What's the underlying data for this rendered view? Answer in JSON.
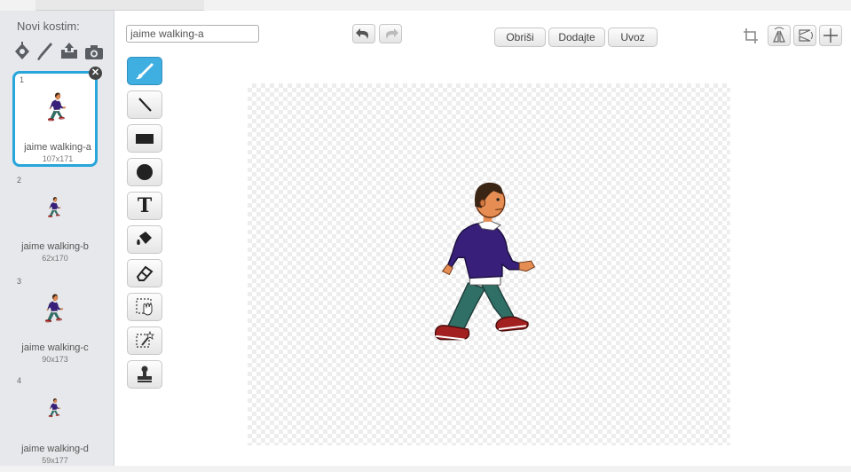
{
  "left_panel": {
    "new_costume_label": "Novi kostim:",
    "new_costume_tools": [
      "paint-new-costume-icon",
      "brush-new-icon",
      "upload-costume-icon",
      "camera-icon"
    ],
    "costumes": [
      {
        "number": "1",
        "name": "jaime walking-a",
        "size": "107x171",
        "selected": true
      },
      {
        "number": "2",
        "name": "jaime walking-b",
        "size": "62x170",
        "selected": false
      },
      {
        "number": "3",
        "name": "jaime walking-c",
        "size": "90x173",
        "selected": false
      },
      {
        "number": "4",
        "name": "jaime walking-d",
        "size": "59x177",
        "selected": false
      }
    ]
  },
  "editor": {
    "costume_name_value": "jaime walking-a",
    "toolbar": {
      "clear_label": "Obriši",
      "add_label": "Dodajte",
      "import_label": "Uvoz"
    },
    "right_tools": [
      "crop-icon",
      "flip-horizontal-icon",
      "flip-vertical-icon",
      "set-center-icon"
    ],
    "draw_tools": [
      "brush-icon",
      "line-icon",
      "rectangle-icon",
      "ellipse-icon",
      "text-icon",
      "fill-bucket-icon",
      "eraser-icon",
      "select-icon",
      "select-remove-background-icon",
      "stamp-icon"
    ],
    "text_tool_glyph": "T",
    "active_tool": "brush-icon"
  },
  "colors": {
    "accent_blue": "#3faee0",
    "selection_border": "#28a5da",
    "panel_bg": "#e6e8eb"
  }
}
